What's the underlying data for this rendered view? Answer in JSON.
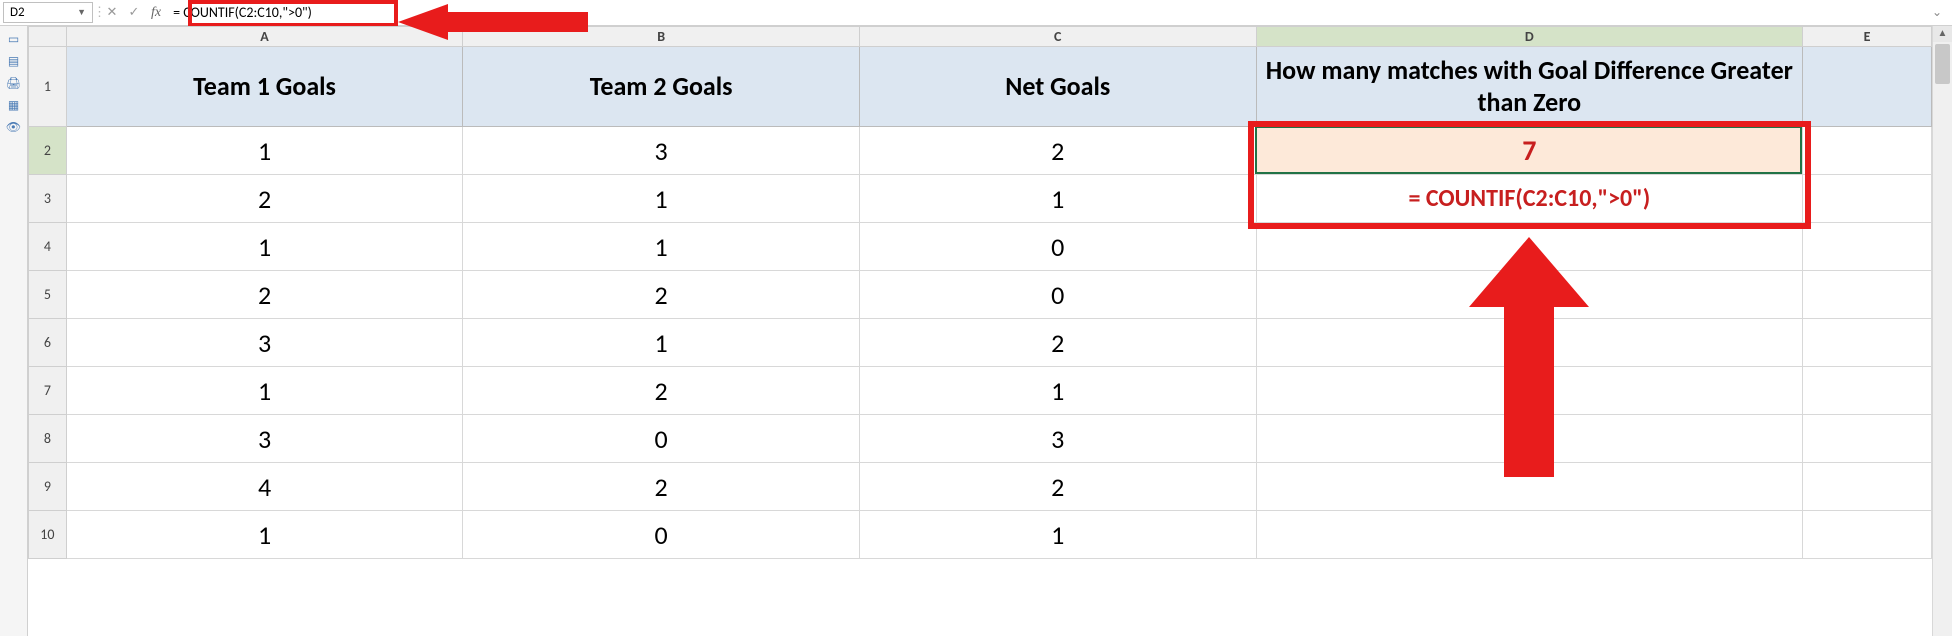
{
  "nameBox": "D2",
  "fxLabel": "fx",
  "formula": "= COUNTIF(C2:C10,\">0\")",
  "columns": [
    "A",
    "B",
    "C",
    "D",
    "E"
  ],
  "rowNumbers": [
    1,
    2,
    3,
    4,
    5,
    6,
    7,
    8,
    9,
    10
  ],
  "selectedColumn": "D",
  "selectedRow": 2,
  "headers": {
    "A": "Team 1 Goals",
    "B": "Team 2 Goals",
    "C": "Net Goals",
    "D": "How many matches with Goal Difference Greater than Zero"
  },
  "data": {
    "team1": [
      1,
      2,
      1,
      2,
      3,
      1,
      3,
      4,
      1
    ],
    "team2": [
      3,
      1,
      1,
      2,
      1,
      2,
      0,
      2,
      0
    ],
    "net": [
      2,
      1,
      0,
      0,
      2,
      1,
      3,
      2,
      1
    ]
  },
  "result": {
    "value": "7",
    "formulaDisplay": "= COUNTIF(C2:C10,\">0\")"
  },
  "chart_data": {
    "type": "table",
    "title": "",
    "columns": [
      "Team 1 Goals",
      "Team 2 Goals",
      "Net Goals"
    ],
    "rows": [
      [
        1,
        3,
        2
      ],
      [
        2,
        1,
        1
      ],
      [
        1,
        1,
        0
      ],
      [
        2,
        2,
        0
      ],
      [
        3,
        1,
        2
      ],
      [
        1,
        2,
        1
      ],
      [
        3,
        0,
        3
      ],
      [
        4,
        2,
        2
      ],
      [
        1,
        0,
        1
      ]
    ],
    "countif_criteria": ">0",
    "countif_range": "C2:C10",
    "countif_result": 7
  }
}
